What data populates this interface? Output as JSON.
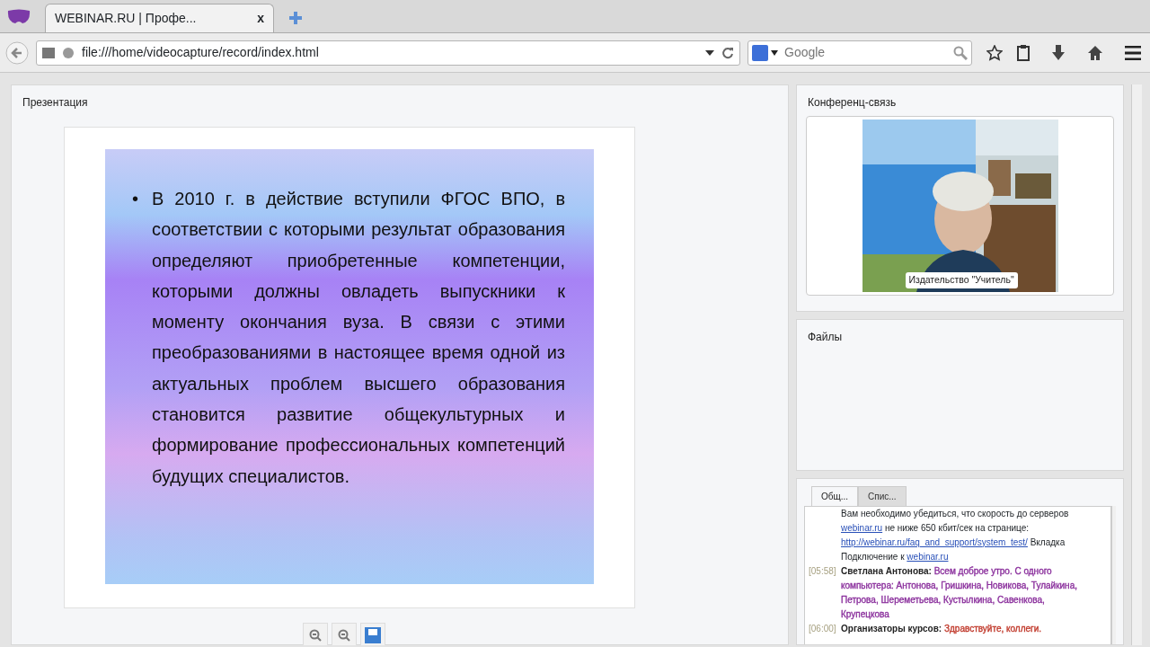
{
  "browser": {
    "tab_title": "WEBINAR.RU | Профе...",
    "tab_close": "x",
    "url": "file:///home/videocapture/record/index.html",
    "search": {
      "placeholder": "Google"
    }
  },
  "presentation": {
    "title": "Презентация",
    "bullets": [
      {
        "marker": "•",
        "text": "В 2010 г. в действие вступили ФГОС ВПО, в соответствии с которыми результат образования определяют приобретенные компетенции, которыми должны овладеть выпускники к моменту окончания вуза. В связи с этими преобразованиями в настоящее время одной из актуальных проблем высшего образования становится развитие общекультурных и формирование профессиональных компетенций будущих специалистов."
      }
    ]
  },
  "conference": {
    "title": "Конференц-связь",
    "caption": "Издательство \"Учитель\""
  },
  "files": {
    "title": "Файлы"
  },
  "chat": {
    "tabs": [
      {
        "label": "Общ...",
        "selected": true
      },
      {
        "label": "Спис...",
        "selected": false
      }
    ],
    "messages": [
      {
        "parts": [
          {
            "kind": "text",
            "text": "Вам необходимо убедиться, что скорость до серверов"
          },
          {
            "kind": "link",
            "text": "webinar.ru"
          },
          {
            "kind": "text",
            "text": "не ниже 650 кбит/сек на странице:"
          },
          {
            "kind": "link",
            "text": "http://webinar.ru/faq_and_support/system_test/"
          },
          {
            "kind": "text",
            "text": "Вкладка Подключение к"
          },
          {
            "kind": "link",
            "text": "webinar.ru"
          }
        ]
      },
      {
        "time": "[05:58]",
        "author": "Светлана Антонова:",
        "color": "#8a2f9c",
        "parts": [
          {
            "kind": "text",
            "text": "Всем доброе утро. С одного компьютера: Антонова, Гришкина, Новикова, Тулайкина, Петрова, Шереметьева, Кустылкина, Савенкова, Крупецкова"
          }
        ]
      },
      {
        "time": "[06:00]",
        "author": "Организаторы курсов:",
        "color": "#c0392b",
        "parts": [
          {
            "kind": "text",
            "text": "Здравствуйте, коллеги."
          }
        ]
      }
    ]
  }
}
